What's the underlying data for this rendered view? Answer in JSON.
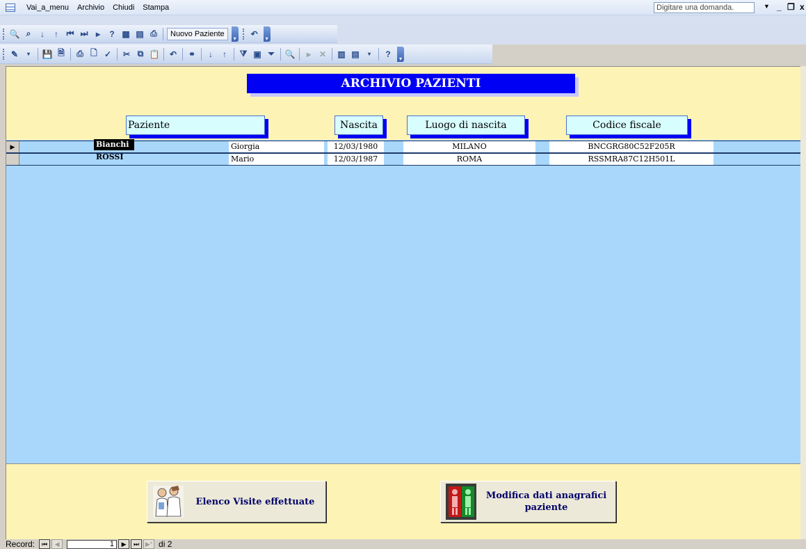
{
  "menu": {
    "items": [
      "Vai_a_menu",
      "Archivio",
      "Chiudi",
      "Stampa"
    ],
    "ask_placeholder": "Digitare una domanda."
  },
  "toolbar1": {
    "button_label": "Nuovo Paziente"
  },
  "form": {
    "title": "ARCHIVIO PAZIENTI",
    "columns": {
      "paziente": "Paziente",
      "nascita": "Nascita",
      "luogo": "Luogo di nascita",
      "codice": "Codice fiscale"
    },
    "rows": [
      {
        "cognome": "Bianchi",
        "nome": "Giorgia",
        "nascita": "12/03/1980",
        "luogo": "MILANO",
        "codice": "BNCGRG80C52F205R"
      },
      {
        "cognome": "ROSSI",
        "nome": "Mario",
        "nascita": "12/03/1987",
        "luogo": "ROMA",
        "codice": "RSSMRA87C12H501L"
      }
    ],
    "buttons": {
      "visite": "Elenco Visite effettuate",
      "modifica_line1": "Modifica dati anagrafici",
      "modifica_line2": "paziente"
    }
  },
  "record_nav": {
    "label": "Record:",
    "current": "1",
    "total_text": "di 2"
  }
}
